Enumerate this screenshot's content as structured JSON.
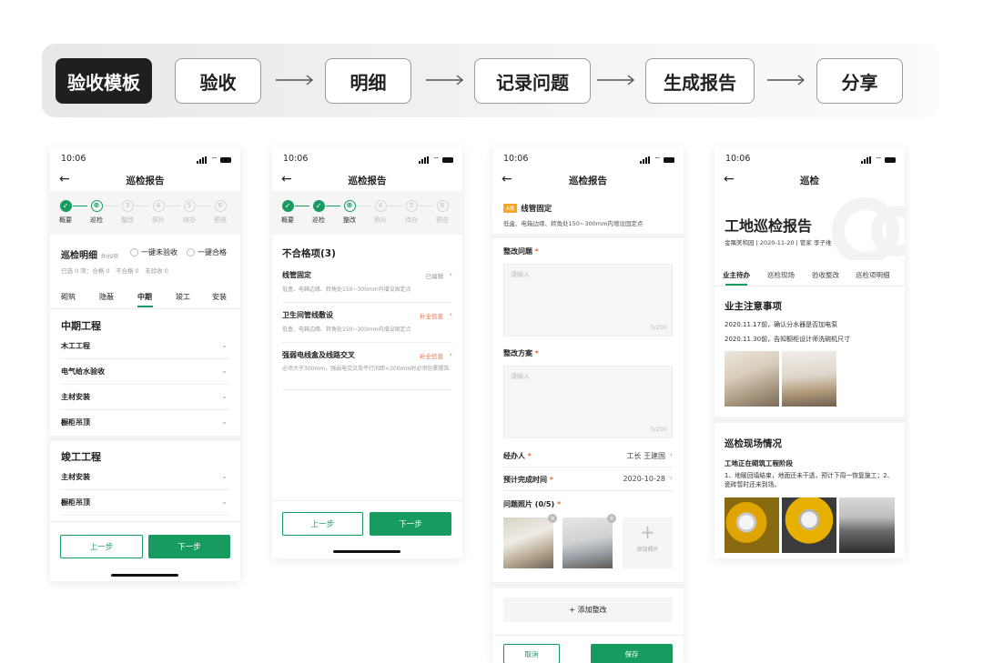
{
  "flow": [
    "验收模板",
    "验收",
    "明细",
    "记录问题",
    "生成报告",
    "分享"
  ],
  "status_time": "10:06",
  "steps": [
    "概要",
    "巡检",
    "整改",
    "照片",
    "待办",
    "预览"
  ],
  "s1": {
    "title": "巡检报告",
    "section_title": "巡检明细",
    "count": "共99项",
    "opt1": "一键未验收",
    "opt2": "一键合格",
    "stats": "已选 0 项：合格 0　不合格 0　未验收 0",
    "tabs": [
      "砌筑",
      "隐蔽",
      "中期",
      "竣工",
      "安装"
    ],
    "group1": "中期工程",
    "group1_items": [
      "木工工程",
      "电气给水验收",
      "主材安装",
      "橱柜吊顶"
    ],
    "group2": "竣工工程",
    "group2_items": [
      "主材安装",
      "橱柜吊顶"
    ],
    "prev": "上一步",
    "next": "下一步"
  },
  "s2": {
    "title": "巡检报告",
    "header": "不合格项(3)",
    "items": [
      {
        "name": "线管固定",
        "status": "已编辑",
        "desc": "低盒、电箱边缘、转角处150~300mm内增设固定点"
      },
      {
        "name": "卫生间管线敷设",
        "status": "补全信息",
        "desc": "低盒、电箱边缘、转角处150~300mm内增设固定点"
      },
      {
        "name": "强弱电线盒及线路交叉",
        "status": "补全信息",
        "desc": "必须大于300mm，强弱电交叉及平行间距<300mm时必须包裹锡箔"
      }
    ],
    "prev": "上一步",
    "next": "下一步"
  },
  "s3": {
    "title": "巡检报告",
    "tag": "A类",
    "item": "线管固定",
    "item_desc": "低盒、电箱边缘、转角处150~300mm内增设固定点",
    "issue_label": "整改问题",
    "plan_label": "整改方案",
    "star": "*",
    "placeholder": "请输入",
    "counter": "0/200",
    "handler_label": "经办人",
    "handler_value": "工长 王建国",
    "date_label": "预计完成时间",
    "date_value": "2020-10-28",
    "photos_label": "问题照片 (0/5)",
    "add_photo": "添加照片",
    "add_fix": "+ 添加整改",
    "cancel": "取消",
    "save": "保存"
  },
  "s4": {
    "title": "巡检",
    "report_title": "工地巡检报告",
    "meta": "金隅美和园 | 2020-11-20 | 管家 李子维",
    "tabs": [
      "业主待办",
      "巡检现场",
      "验收整改",
      "巡检项明细"
    ],
    "notes_title": "业主注意事项",
    "notes": [
      "2020.11.17前，确认分水器是否加电泵",
      "2020.11.30前，告知橱柜设计师洗碗机尺寸"
    ],
    "site_title": "巡检现场情况",
    "site_sub": "工地正在砌筑工程阶段",
    "site_desc": "1、地暖回填结束，地面还未干透，预计下周一恢复施工；2、瓷砖暂时还未到场。"
  }
}
